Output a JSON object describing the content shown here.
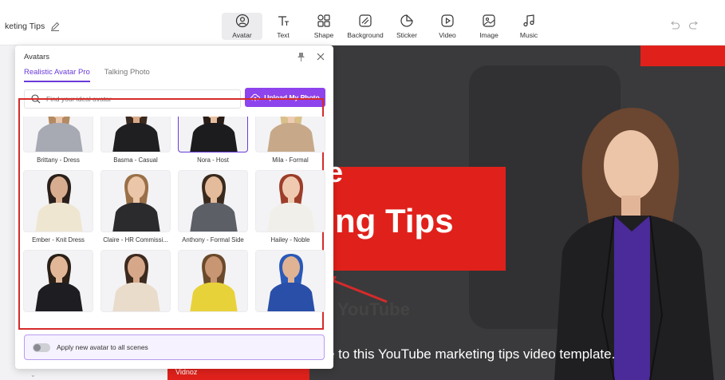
{
  "project": {
    "title": "keting Tips"
  },
  "toolbar": {
    "tools": [
      {
        "label": "Avatar",
        "icon": "avatar-icon"
      },
      {
        "label": "Text",
        "icon": "text-icon"
      },
      {
        "label": "Shape",
        "icon": "shape-icon"
      },
      {
        "label": "Background",
        "icon": "background-icon"
      },
      {
        "label": "Sticker",
        "icon": "sticker-icon"
      },
      {
        "label": "Video",
        "icon": "video-icon"
      },
      {
        "label": "Image",
        "icon": "image-icon"
      },
      {
        "label": "Music",
        "icon": "music-icon"
      }
    ],
    "active": "Avatar"
  },
  "panel": {
    "title": "Avatars",
    "tabs": [
      "Realistic Avatar Pro",
      "Talking Photo"
    ],
    "active_tab": "Realistic Avatar Pro",
    "search_placeholder": "Find your ideal avatar",
    "upload_label": "Upload My Photo",
    "avatars": [
      {
        "name": "Brittany - Dress",
        "outfit": "#a7a9b3",
        "hair": "#b48a62",
        "skin": "#e8c4a8"
      },
      {
        "name": "Basma - Casual",
        "outfit": "#1f1f22",
        "hair": "#3b2a20",
        "skin": "#d9aa88"
      },
      {
        "name": "Nora - Host",
        "outfit": "#1c1c1f",
        "hair": "#2a1d18",
        "skin": "#e6bfa1"
      },
      {
        "name": "Mila - Formal",
        "outfit": "#c7a98a",
        "hair": "#d9c08a",
        "skin": "#efcdb4"
      },
      {
        "name": "Ember - Knit Dress",
        "outfit": "#efe6d2",
        "hair": "#2a1f1a",
        "skin": "#d8ad8f"
      },
      {
        "name": "Claire - HR Commissi...",
        "outfit": "#2b2b2e",
        "hair": "#9a7048",
        "skin": "#ebc6a8"
      },
      {
        "name": "Anthony - Formal Side",
        "outfit": "#5c5f66",
        "hair": "#3a2a1e",
        "skin": "#e4bb9b"
      },
      {
        "name": "Hailey - Noble",
        "outfit": "#f1efe9",
        "hair": "#9c3e2a",
        "skin": "#efcab0"
      },
      {
        "name": "",
        "outfit": "#1e1e22",
        "hair": "#2a2018",
        "skin": "#e2b797"
      },
      {
        "name": "",
        "outfit": "#e9dccb",
        "hair": "#3d2a1f",
        "skin": "#d6a889"
      },
      {
        "name": "",
        "outfit": "#e8d23a",
        "hair": "#6b4a2c",
        "skin": "#c99673"
      },
      {
        "name": "",
        "outfit": "#2a4fa8",
        "hair": "#2a59b8",
        "skin": "#e0b394"
      }
    ],
    "apply_label": "Apply new avatar to all scenes"
  },
  "canvas": {
    "headline_line1": "e",
    "headline_line2": "ng Tips",
    "subtitle": "e to this YouTube marketing tips video template.",
    "brand": "Vidnoz",
    "yt_label": "YouTube"
  }
}
